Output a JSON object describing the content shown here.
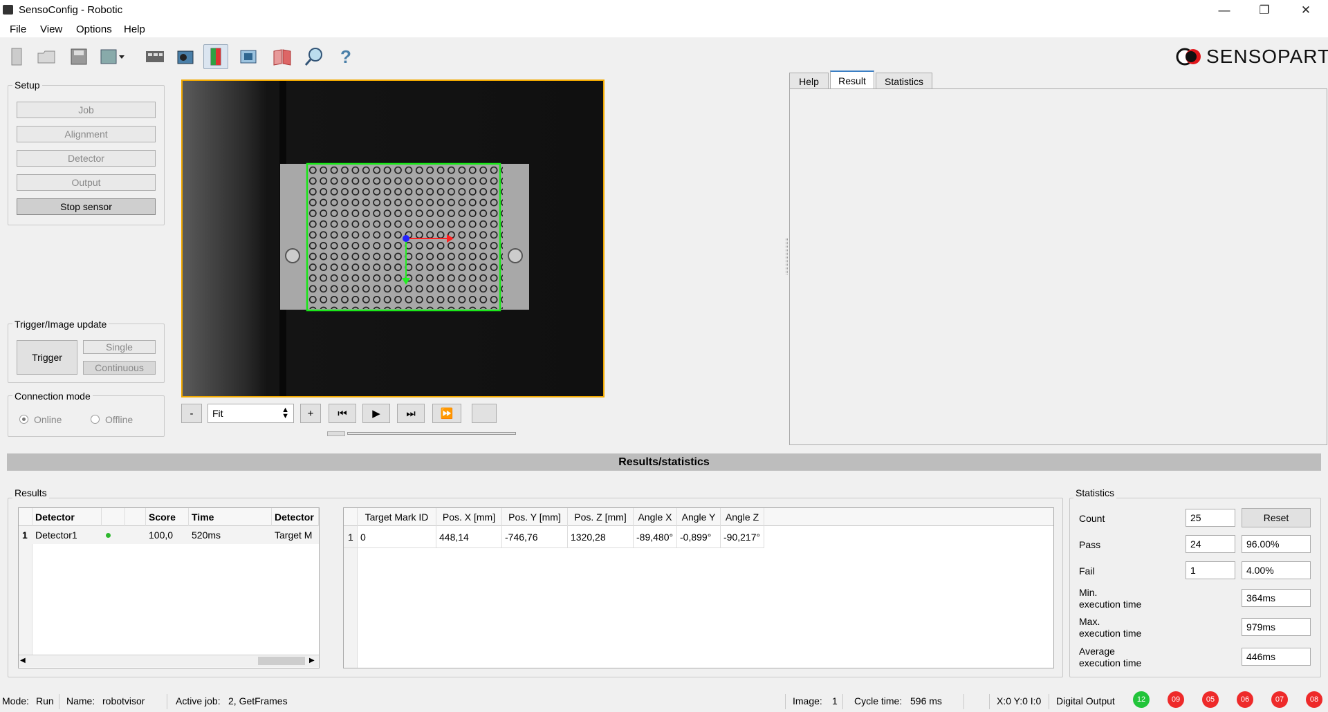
{
  "window": {
    "title": "SensoConfig - Robotic"
  },
  "menu": [
    "File",
    "View",
    "Options",
    "Help"
  ],
  "brand": {
    "name": "SENSOPART"
  },
  "setup": {
    "title": "Setup",
    "buttons": [
      "Job",
      "Alignment",
      "Detector",
      "Output",
      "Stop sensor"
    ]
  },
  "trigger": {
    "title": "Trigger/Image update",
    "trigger": "Trigger",
    "single": "Single",
    "continuous": "Continuous"
  },
  "connection": {
    "title": "Connection mode",
    "online": "Online",
    "offline": "Offline",
    "selected": "Online"
  },
  "viewer": {
    "zoom_minus": "-",
    "zoom_value": "Fit",
    "zoom_plus": "+"
  },
  "tabs": [
    {
      "label": "Help",
      "active": false
    },
    {
      "label": "Result",
      "active": true
    },
    {
      "label": "Statistics",
      "active": false
    }
  ],
  "section_bar": "Results/statistics",
  "results": {
    "title": "Results",
    "columns": [
      "Detector",
      "",
      "Score",
      "Time",
      "Detector"
    ],
    "rows": [
      {
        "num": "1",
        "detector": "Detector1",
        "score": "100,0",
        "time": "520ms",
        "type": "Target M"
      }
    ]
  },
  "target": {
    "columns": [
      "Target Mark ID",
      "Pos. X [mm]",
      "Pos. Y [mm]",
      "Pos. Z [mm]",
      "Angle X",
      "Angle Y",
      "Angle Z"
    ],
    "rows": [
      {
        "num": "1",
        "cells": [
          "0",
          "448,14",
          "-746,76",
          "1320,28",
          "-89,480°",
          "-0,899°",
          "-90,217°"
        ]
      }
    ]
  },
  "statistics": {
    "title": "Statistics",
    "count_label": "Count",
    "count": "25",
    "reset": "Reset",
    "pass_label": "Pass",
    "pass": "24",
    "pass_pct": "96.00%",
    "fail_label": "Fail",
    "fail": "1",
    "fail_pct": "4.00%",
    "min_label": "Min.",
    "min_label2": "execution time",
    "min": "364ms",
    "max_label": "Max.",
    "max_label2": "execution time",
    "max": "979ms",
    "avg_label": "Average",
    "avg_label2": "execution time",
    "avg": "446ms"
  },
  "status": {
    "mode_label": "Mode:",
    "mode": "Run",
    "name_label": "Name:",
    "name": "robotvisor",
    "job_label": "Active job:",
    "job": "2, GetFrames",
    "image_label": "Image:",
    "image": "1",
    "cycle_label": "Cycle time:",
    "cycle": "596 ms",
    "coords": "X:0 Y:0 I:0",
    "digital": "Digital Output",
    "outputs": [
      {
        "label": "12",
        "color": "#22c43a"
      },
      {
        "label": "09",
        "color": "#ee2a2a"
      },
      {
        "label": "05",
        "color": "#ee2a2a"
      },
      {
        "label": "06",
        "color": "#ee2a2a"
      },
      {
        "label": "07",
        "color": "#ee2a2a"
      },
      {
        "label": "08",
        "color": "#ee2a2a"
      }
    ]
  }
}
